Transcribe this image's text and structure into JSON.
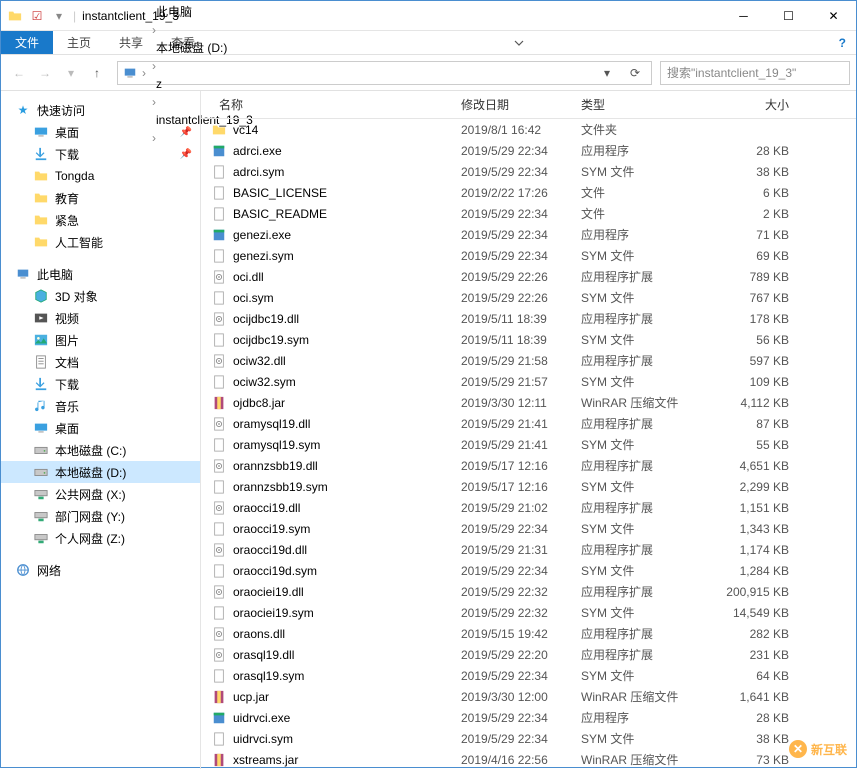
{
  "window": {
    "title": "instantclient_19_3"
  },
  "ribbon": {
    "file": "文件",
    "home": "主页",
    "share": "共享",
    "view": "查看"
  },
  "breadcrumb": [
    "此电脑",
    "本地磁盘 (D:)",
    "z",
    "instantclient_19_3"
  ],
  "search_placeholder": "搜索\"instantclient_19_3\"",
  "sidebar": {
    "quick": {
      "label": "快速访问",
      "items": [
        {
          "label": "桌面",
          "pin": true,
          "icon": "desktop"
        },
        {
          "label": "下载",
          "pin": true,
          "icon": "download"
        },
        {
          "label": "Tongda",
          "icon": "folder"
        },
        {
          "label": "教育",
          "icon": "folder"
        },
        {
          "label": "紧急",
          "icon": "folder"
        },
        {
          "label": "人工智能",
          "icon": "folder"
        }
      ]
    },
    "thispc": {
      "label": "此电脑",
      "items": [
        {
          "label": "3D 对象",
          "icon": "3d"
        },
        {
          "label": "视频",
          "icon": "video"
        },
        {
          "label": "图片",
          "icon": "picture"
        },
        {
          "label": "文档",
          "icon": "document"
        },
        {
          "label": "下载",
          "icon": "download"
        },
        {
          "label": "音乐",
          "icon": "music"
        },
        {
          "label": "桌面",
          "icon": "desktop"
        },
        {
          "label": "本地磁盘 (C:)",
          "icon": "drive"
        },
        {
          "label": "本地磁盘 (D:)",
          "icon": "drive",
          "selected": true
        },
        {
          "label": "公共网盘 (X:)",
          "icon": "netdrive"
        },
        {
          "label": "部门网盘 (Y:)",
          "icon": "netdrive"
        },
        {
          "label": "个人网盘 (Z:)",
          "icon": "netdrive"
        }
      ]
    },
    "network": {
      "label": "网络"
    }
  },
  "columns": {
    "name": "名称",
    "date": "修改日期",
    "type": "类型",
    "size": "大小"
  },
  "files": [
    {
      "icon": "folder",
      "name": "vc14",
      "date": "2019/8/1 16:42",
      "type": "文件夹",
      "size": ""
    },
    {
      "icon": "exe",
      "name": "adrci.exe",
      "date": "2019/5/29 22:34",
      "type": "应用程序",
      "size": "28 KB"
    },
    {
      "icon": "file",
      "name": "adrci.sym",
      "date": "2019/5/29 22:34",
      "type": "SYM 文件",
      "size": "38 KB"
    },
    {
      "icon": "file",
      "name": "BASIC_LICENSE",
      "date": "2019/2/22 17:26",
      "type": "文件",
      "size": "6 KB"
    },
    {
      "icon": "file",
      "name": "BASIC_README",
      "date": "2019/5/29 22:34",
      "type": "文件",
      "size": "2 KB"
    },
    {
      "icon": "exe",
      "name": "genezi.exe",
      "date": "2019/5/29 22:34",
      "type": "应用程序",
      "size": "71 KB"
    },
    {
      "icon": "file",
      "name": "genezi.sym",
      "date": "2019/5/29 22:34",
      "type": "SYM 文件",
      "size": "69 KB"
    },
    {
      "icon": "dll",
      "name": "oci.dll",
      "date": "2019/5/29 22:26",
      "type": "应用程序扩展",
      "size": "789 KB"
    },
    {
      "icon": "file",
      "name": "oci.sym",
      "date": "2019/5/29 22:26",
      "type": "SYM 文件",
      "size": "767 KB"
    },
    {
      "icon": "dll",
      "name": "ocijdbc19.dll",
      "date": "2019/5/11 18:39",
      "type": "应用程序扩展",
      "size": "178 KB"
    },
    {
      "icon": "file",
      "name": "ocijdbc19.sym",
      "date": "2019/5/11 18:39",
      "type": "SYM 文件",
      "size": "56 KB"
    },
    {
      "icon": "dll",
      "name": "ociw32.dll",
      "date": "2019/5/29 21:58",
      "type": "应用程序扩展",
      "size": "597 KB"
    },
    {
      "icon": "file",
      "name": "ociw32.sym",
      "date": "2019/5/29 21:57",
      "type": "SYM 文件",
      "size": "109 KB"
    },
    {
      "icon": "jar",
      "name": "ojdbc8.jar",
      "date": "2019/3/30 12:11",
      "type": "WinRAR 压缩文件",
      "size": "4,112 KB"
    },
    {
      "icon": "dll",
      "name": "oramysql19.dll",
      "date": "2019/5/29 21:41",
      "type": "应用程序扩展",
      "size": "87 KB"
    },
    {
      "icon": "file",
      "name": "oramysql19.sym",
      "date": "2019/5/29 21:41",
      "type": "SYM 文件",
      "size": "55 KB"
    },
    {
      "icon": "dll",
      "name": "orannzsbb19.dll",
      "date": "2019/5/17 12:16",
      "type": "应用程序扩展",
      "size": "4,651 KB"
    },
    {
      "icon": "file",
      "name": "orannzsbb19.sym",
      "date": "2019/5/17 12:16",
      "type": "SYM 文件",
      "size": "2,299 KB"
    },
    {
      "icon": "dll",
      "name": "oraocci19.dll",
      "date": "2019/5/29 21:02",
      "type": "应用程序扩展",
      "size": "1,151 KB"
    },
    {
      "icon": "file",
      "name": "oraocci19.sym",
      "date": "2019/5/29 22:34",
      "type": "SYM 文件",
      "size": "1,343 KB"
    },
    {
      "icon": "dll",
      "name": "oraocci19d.dll",
      "date": "2019/5/29 21:31",
      "type": "应用程序扩展",
      "size": "1,174 KB"
    },
    {
      "icon": "file",
      "name": "oraocci19d.sym",
      "date": "2019/5/29 22:34",
      "type": "SYM 文件",
      "size": "1,284 KB"
    },
    {
      "icon": "dll",
      "name": "oraociei19.dll",
      "date": "2019/5/29 22:32",
      "type": "应用程序扩展",
      "size": "200,915 KB"
    },
    {
      "icon": "file",
      "name": "oraociei19.sym",
      "date": "2019/5/29 22:32",
      "type": "SYM 文件",
      "size": "14,549 KB"
    },
    {
      "icon": "dll",
      "name": "oraons.dll",
      "date": "2019/5/15 19:42",
      "type": "应用程序扩展",
      "size": "282 KB"
    },
    {
      "icon": "dll",
      "name": "orasql19.dll",
      "date": "2019/5/29 22:20",
      "type": "应用程序扩展",
      "size": "231 KB"
    },
    {
      "icon": "file",
      "name": "orasql19.sym",
      "date": "2019/5/29 22:34",
      "type": "SYM 文件",
      "size": "64 KB"
    },
    {
      "icon": "jar",
      "name": "ucp.jar",
      "date": "2019/3/30 12:00",
      "type": "WinRAR 压缩文件",
      "size": "1,641 KB"
    },
    {
      "icon": "exe",
      "name": "uidrvci.exe",
      "date": "2019/5/29 22:34",
      "type": "应用程序",
      "size": "28 KB"
    },
    {
      "icon": "file",
      "name": "uidrvci.sym",
      "date": "2019/5/29 22:34",
      "type": "SYM 文件",
      "size": "38 KB"
    },
    {
      "icon": "jar",
      "name": "xstreams.jar",
      "date": "2019/4/16 22:56",
      "type": "WinRAR 压缩文件",
      "size": "73 KB"
    }
  ],
  "watermark": "新互联"
}
